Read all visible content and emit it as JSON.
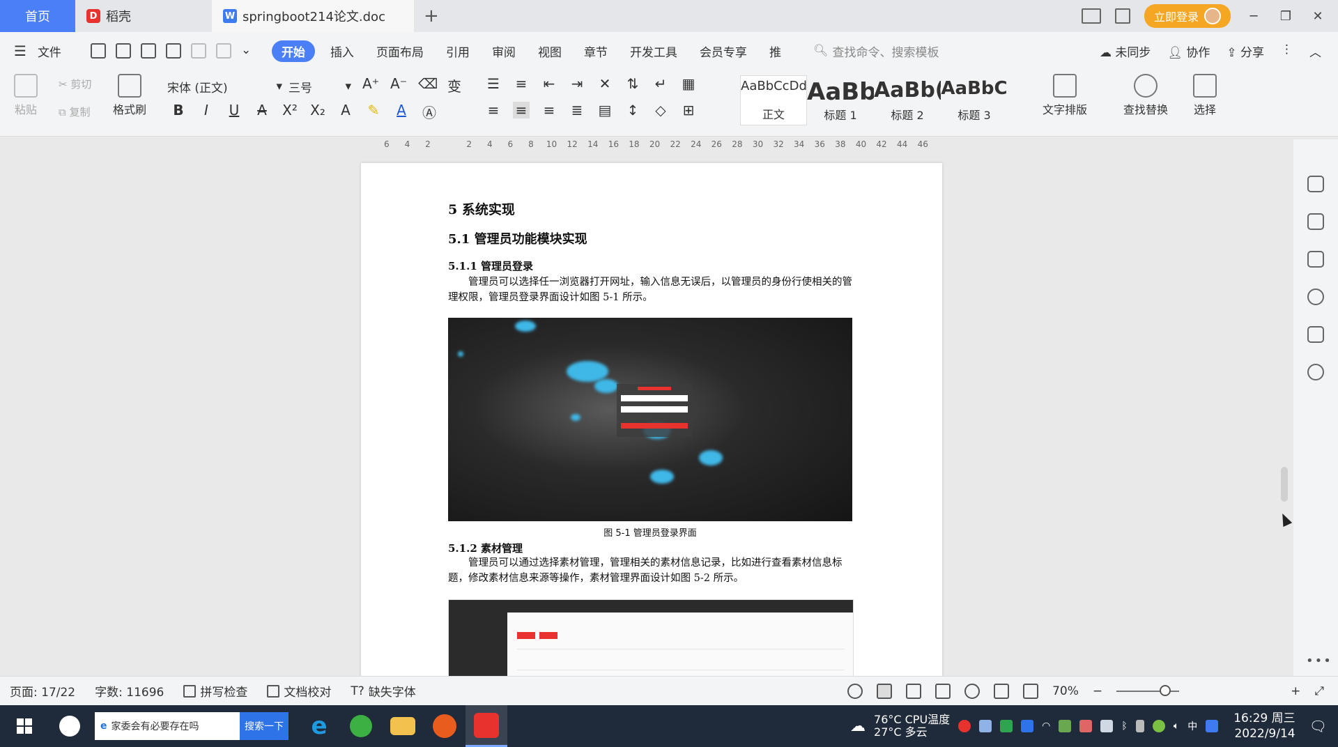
{
  "tabs": {
    "home": "首页",
    "daoke": "稻壳",
    "doc": "springboot214论文.doc",
    "add": "+"
  },
  "titlebar": {
    "login": "立即登录"
  },
  "menu": {
    "file": "文件",
    "items": [
      "开始",
      "插入",
      "页面布局",
      "引用",
      "审阅",
      "视图",
      "章节",
      "开发工具",
      "会员专享",
      "推"
    ],
    "search_command": "查找命令、搜索模板",
    "sync": "未同步",
    "collab": "协作",
    "share": "分享"
  },
  "ribbon": {
    "paste": "粘贴",
    "cut": "剪切",
    "copy": "复制",
    "format_painter": "格式刷",
    "font_name": "宋体 (正文)",
    "font_size": "三号",
    "styles": [
      {
        "preview": "AaBbCcDd",
        "label": "正文"
      },
      {
        "preview": "AaBb",
        "label": "标题 1"
      },
      {
        "preview": "AaBb(",
        "label": "标题 2"
      },
      {
        "preview": "AaBbC",
        "label": "标题 3"
      }
    ],
    "text_layout": "文字排版",
    "find_replace": "查找替换",
    "select": "选择"
  },
  "ruler": [
    "6",
    "4",
    "2",
    "",
    "2",
    "4",
    "6",
    "8",
    "10",
    "12",
    "14",
    "16",
    "18",
    "20",
    "22",
    "24",
    "26",
    "28",
    "30",
    "32",
    "34",
    "36",
    "38",
    "40",
    "42",
    "44",
    "46"
  ],
  "document": {
    "chapter": "5 系统实现",
    "section": "5.1 管理员功能模块实现",
    "sub1": "5.1.1 管理员登录",
    "para1": "管理员可以选择任一浏览器打开网址，输入信息无误后，以管理员的身份行使相关的管理权限，管理员登录界面设计如图 5-1 所示。",
    "caption1": "图 5-1 管理员登录界面",
    "sub2": "5.1.2 素材管理",
    "para2": "管理员可以通过选择素材管理，管理相关的素材信息记录，比如进行查看素材信息标题，修改素材信息来源等操作，素材管理界面设计如图 5-2 所示。"
  },
  "status": {
    "page": "页面: 17/22",
    "words": "字数: 11696",
    "spell": "拼写检查",
    "proof": "文档校对",
    "missing_font": "缺失字体",
    "zoom": "70%"
  },
  "taskbar": {
    "search_text": "家委会有必要存在吗",
    "search_btn": "搜索一下",
    "weather_temp": "27°C 多云",
    "cpu": "76°C CPU温度",
    "ime": "中",
    "time": "16:29 周三",
    "date": "2022/9/14"
  }
}
